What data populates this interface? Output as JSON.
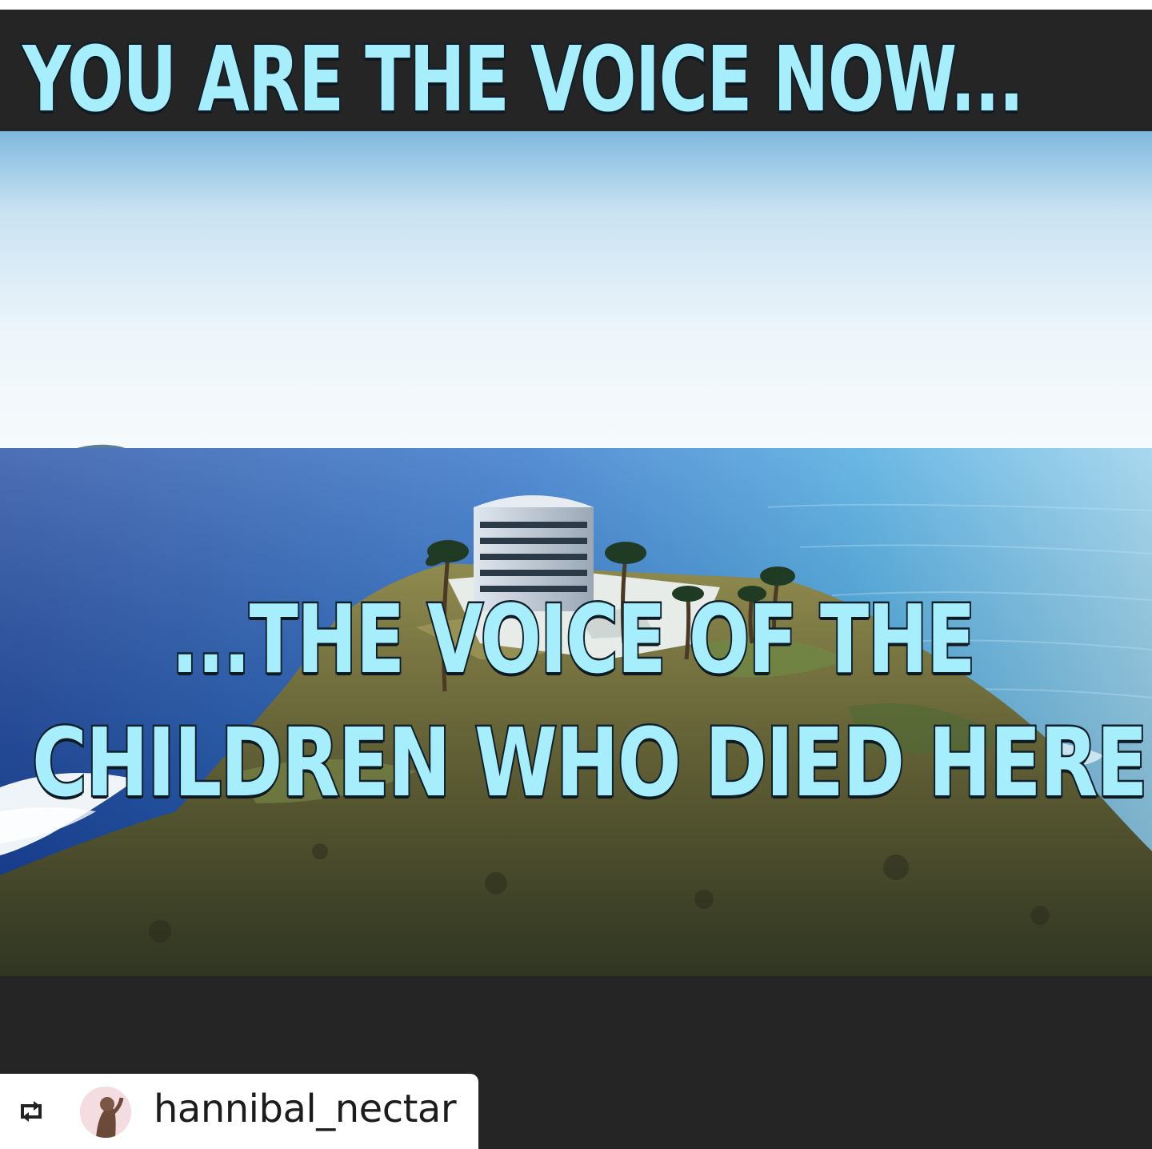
{
  "meme": {
    "top_text": "YOU ARE THE VOICE NOW...",
    "middle_text": "...THE VOICE OF THE",
    "bottom_text": "CHILDREN WHO DIED HERE"
  },
  "repost": {
    "icon": "repost-icon",
    "avatar_icon": "user-avatar",
    "username": "hannibal_nectar"
  },
  "colors": {
    "caption_fill": "#a6eefc",
    "caption_outline": "#10212c",
    "frame_dark": "#252525"
  }
}
